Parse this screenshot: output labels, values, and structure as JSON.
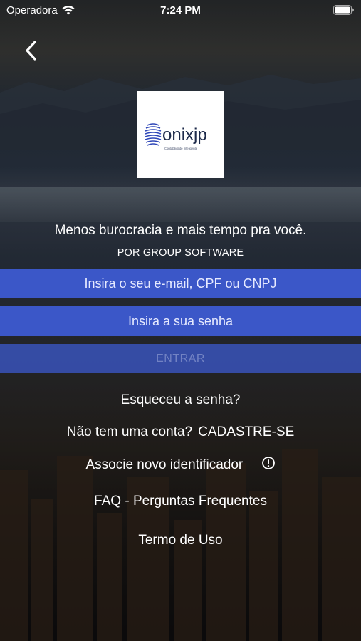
{
  "status_bar": {
    "carrier": "Operadora",
    "time": "7:24 PM"
  },
  "logo": {
    "name": "onixjp",
    "subtitle": "Contabilidade Inteligente"
  },
  "header": {
    "tagline": "Menos burocracia e mais tempo pra você.",
    "by_line": "POR GROUP SOFTWARE"
  },
  "form": {
    "email_placeholder": "Insira o seu e-mail, CPF ou CNPJ",
    "password_placeholder": "Insira a sua senha",
    "submit_label": "ENTRAR"
  },
  "links": {
    "forgot": "Esqueceu a senha?",
    "no_account": "Não tem uma conta?",
    "signup": "CADASTRE-SE",
    "associate": "Associe novo identificador",
    "faq": "FAQ - Perguntas Frequentes",
    "terms": "Termo de Uso"
  },
  "colors": {
    "field_bg": "#3b57c8",
    "text": "#ffffff"
  },
  "icons": {
    "back": "chevron-left-icon",
    "info": "info-circle-icon",
    "wifi": "wifi-icon",
    "battery": "battery-icon"
  }
}
